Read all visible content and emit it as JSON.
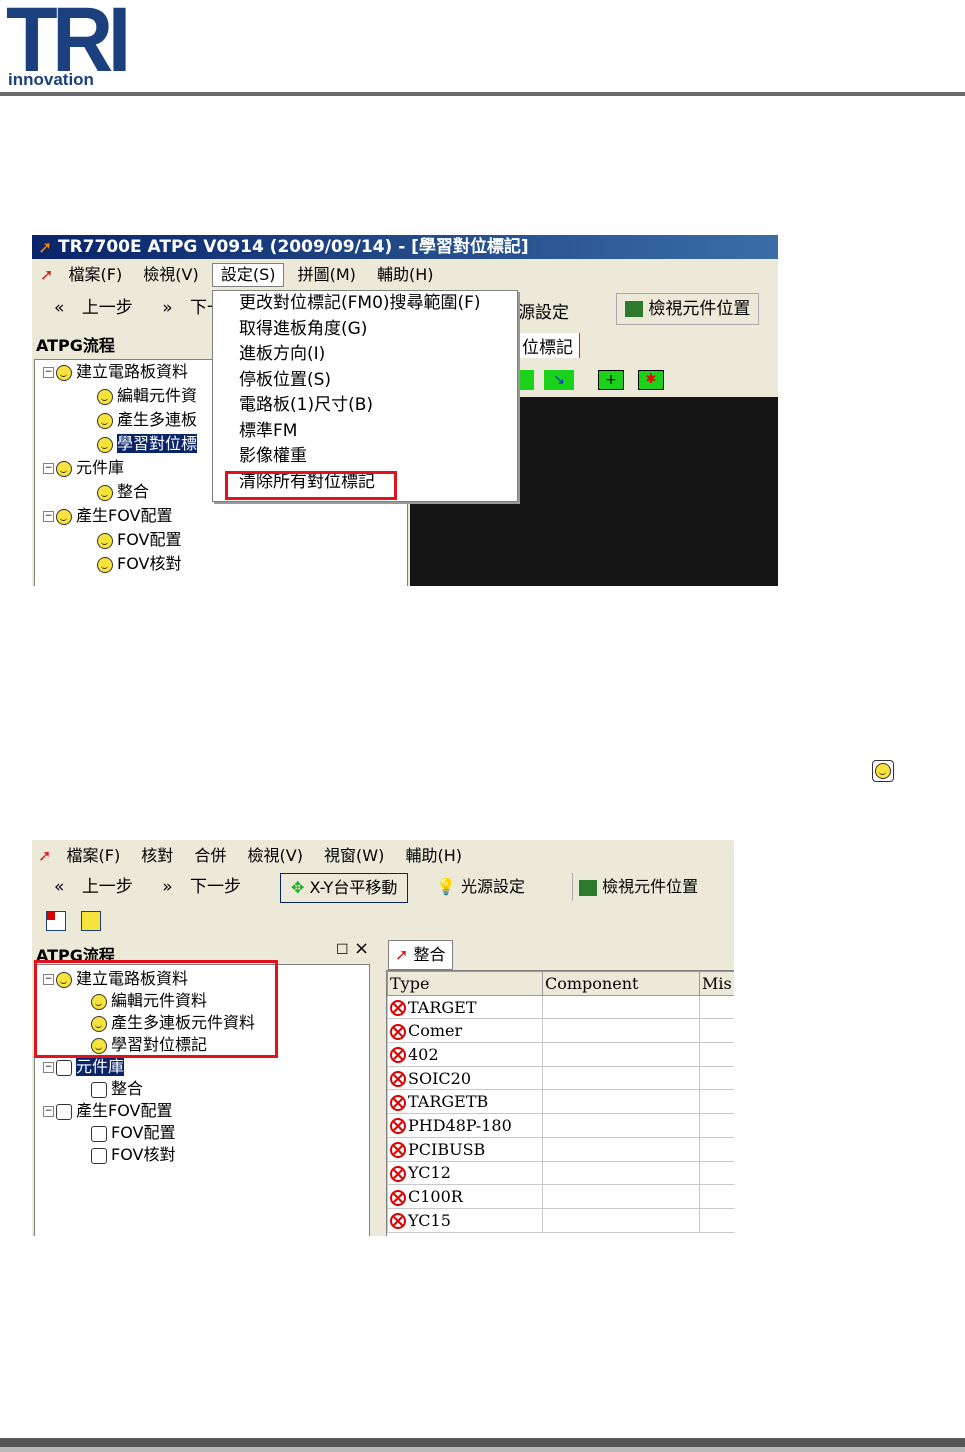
{
  "header": {
    "logo_main": "TRI",
    "logo_sub": "innovation"
  },
  "shot1": {
    "title": "TR7700E ATPG V0914 (2009/09/14) - [學習對位標記]",
    "menu": [
      "檔案(F)",
      "檢視(V)",
      "設定(S)",
      "拼圖(M)",
      "輔助(H)"
    ],
    "toolbar": {
      "prev": "上一步",
      "next": "下一",
      "light_tail": "源設定",
      "view_pos": "檢視元件位置"
    },
    "panel_title": "ATPG流程",
    "tab_label": "位標記",
    "tree": [
      "建立電路板資料",
      "編輯元件資",
      "產生多連板",
      "學習對位標",
      "元件庫",
      "整合",
      "產生FOV配置",
      "FOV配置",
      "FOV核對"
    ],
    "dropdown": [
      "更改對位標記(FM0)搜尋範圍(F)",
      "取得進板角度(G)",
      "進板方向(I)",
      "停板位置(S)",
      "電路板(1)尺寸(B)",
      "標準FM",
      "影像權重",
      "清除所有對位標記"
    ]
  },
  "shot2": {
    "menu": [
      "檔案(F)",
      "核對",
      "合併",
      "檢視(V)",
      "視窗(W)",
      "輔助(H)"
    ],
    "toolbar": {
      "prev": "上一步",
      "next": "下一步",
      "xy": "X-Y台平移動",
      "light": "光源設定",
      "view_pos": "檢視元件位置"
    },
    "panel_title": "ATPG流程",
    "tab_label": "整合",
    "tree": [
      "建立電路板資料",
      "編輯元件資料",
      "產生多連板元件資料",
      "學習對位標記",
      "元件庫",
      "整合",
      "產生FOV配置",
      "FOV配置",
      "FOV核對"
    ],
    "columns": [
      "Type",
      "Component",
      "Mis"
    ],
    "rows": [
      "TARGET",
      "Comer",
      "402",
      "SOIC20",
      "TARGETB",
      "PHD48P-180",
      "PCIBUSB",
      "YC12",
      "C100R",
      "YC15"
    ]
  }
}
